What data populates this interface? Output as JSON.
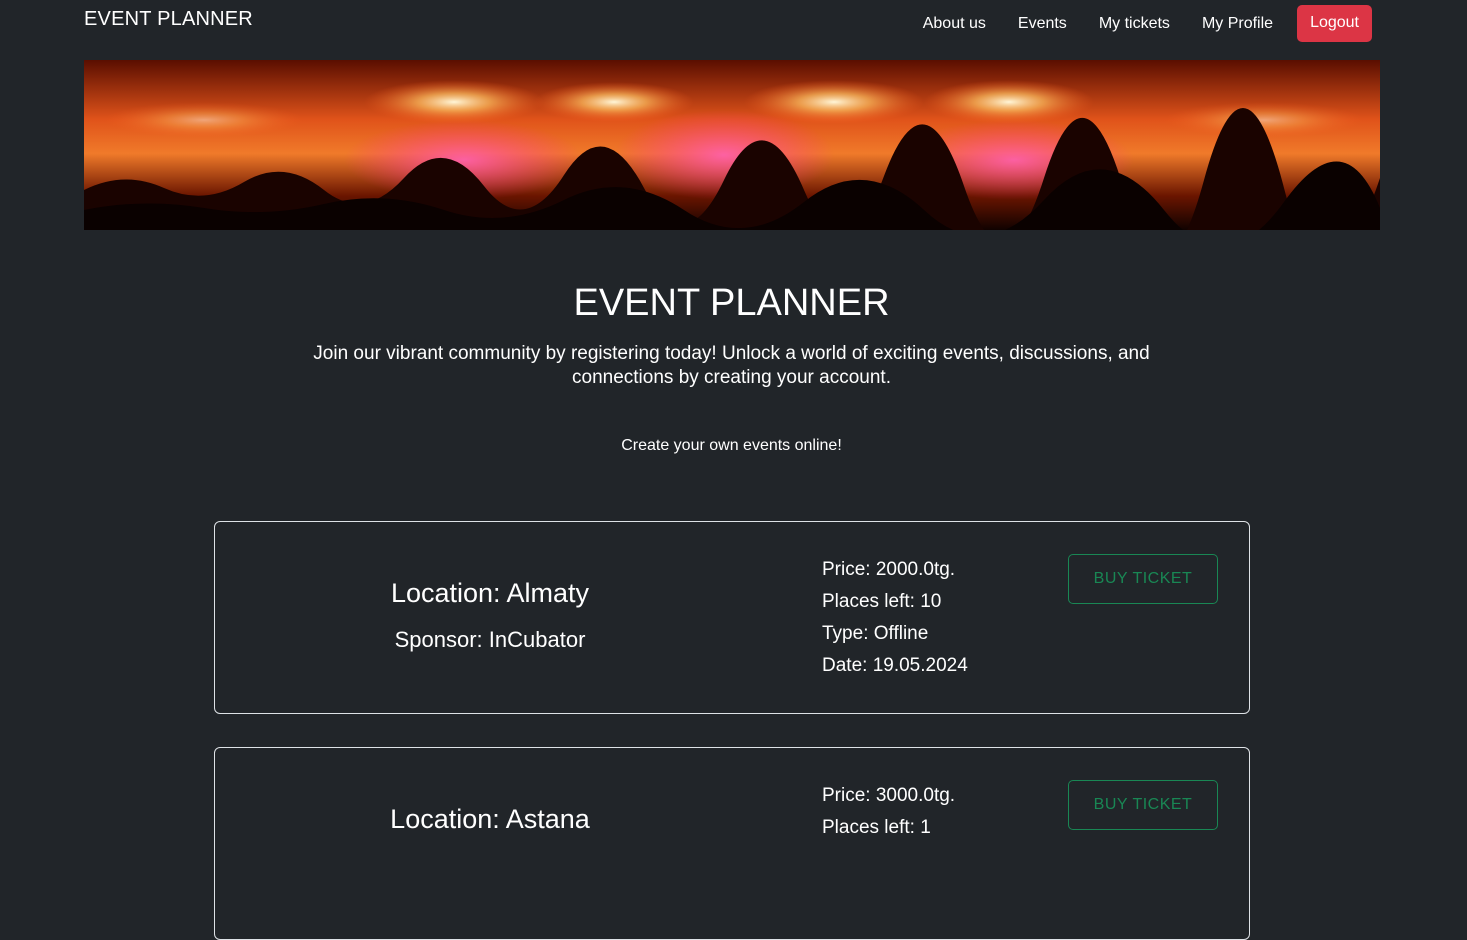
{
  "nav": {
    "brand": "EVENT PLANNER",
    "links": [
      "About us",
      "Events",
      "My tickets",
      "My Profile"
    ],
    "logout_label": "Logout"
  },
  "hero": {
    "title": "EVENT PLANNER",
    "text": "Join our vibrant community by registering today! Unlock a world of exciting events, discussions, and connections by creating your account.",
    "subtext": "Create your own events online!"
  },
  "events": [
    {
      "location": "Location: Almaty",
      "sponsor": "Sponsor: InCubator",
      "price": "Price: 2000.0tg.",
      "places": "Places left: 10",
      "type": "Type: Offline",
      "date": "Date: 19.05.2024",
      "button_label": "BUY TICKET"
    },
    {
      "location": "Location: Astana",
      "price": "Price: 3000.0tg.",
      "places": "Places left: 1",
      "button_label": "BUY TICKET"
    }
  ],
  "colors": {
    "background": "#212529",
    "logout": "#dc3545",
    "buy": "#198754"
  }
}
